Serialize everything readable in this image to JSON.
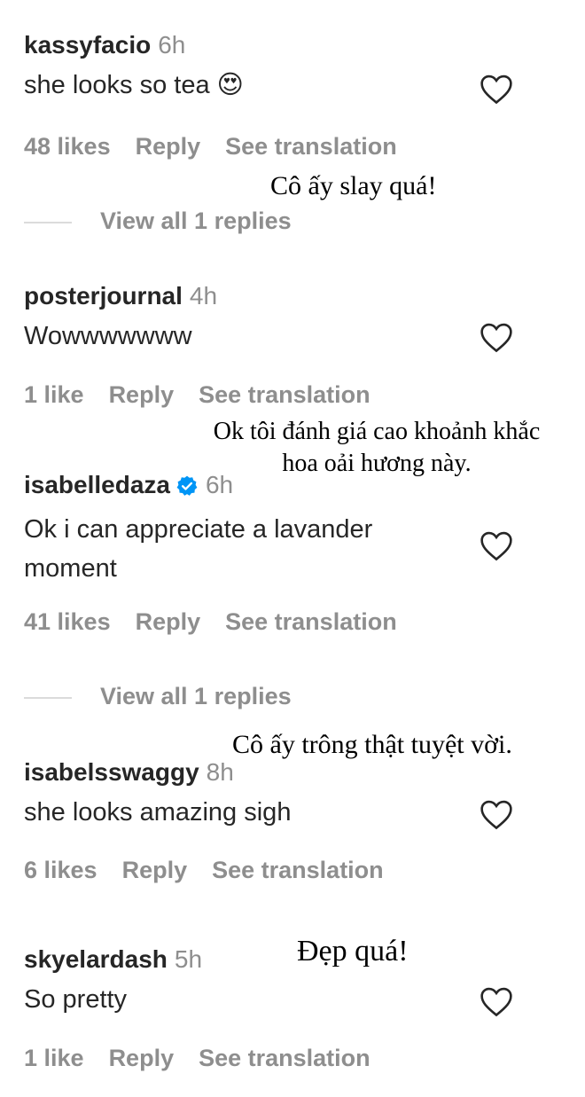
{
  "comments": [
    {
      "username": "kassyfacio",
      "time": "6h",
      "text": "she looks so tea 😍",
      "likes": "48 likes",
      "reply": "Reply",
      "translate": "See translation",
      "view_replies": "View all 1 replies",
      "overlay": "Cô ấy slay quá!"
    },
    {
      "username": "posterjournal",
      "time": "4h",
      "text": "Wowwwwwww",
      "likes": "1 like",
      "reply": "Reply",
      "translate": "See translation",
      "overlay_line1": "Ok tôi đánh giá cao khoảnh khắc",
      "overlay_line2": "hoa oải hương này."
    },
    {
      "username": "isabelledaza",
      "time": "6h",
      "text": "Ok i can appreciate a lavander moment",
      "likes": "41 likes",
      "reply": "Reply",
      "translate": "See translation",
      "view_replies": "View all 1 replies",
      "verified": true
    },
    {
      "username": "isabelsswaggy",
      "time": "8h",
      "text": "she looks amazing sigh",
      "likes": "6 likes",
      "reply": "Reply",
      "translate": "See translation",
      "overlay": "Cô ấy trông thật tuyệt vời."
    },
    {
      "username": "skyelardash",
      "time": "5h",
      "text": "So pretty",
      "likes": "1 like",
      "reply": "Reply",
      "translate": "See translation",
      "overlay": "Đẹp quá!"
    }
  ],
  "colors": {
    "text": "#262626",
    "secondary": "#8e8e8e",
    "verified": "#0095f6",
    "divider": "#dbdbdb"
  },
  "icons": {
    "like": "heart-outline-icon",
    "verified": "verified-badge-icon"
  }
}
